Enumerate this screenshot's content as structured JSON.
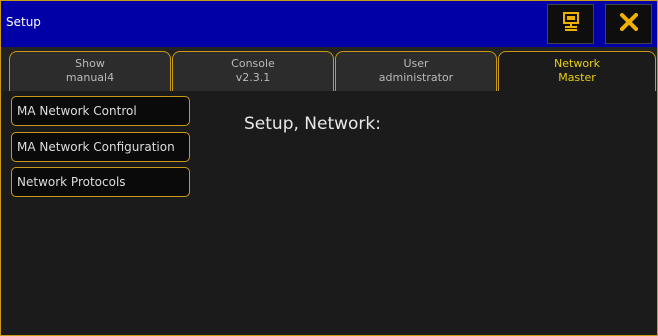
{
  "window": {
    "title": "Setup"
  },
  "titlebar_buttons": {
    "display_icon": "screen-icon",
    "close_icon": "close-icon",
    "close_symbol": "✕"
  },
  "tabs": [
    {
      "title": "Show",
      "value": "manual4",
      "active": false
    },
    {
      "title": "Console",
      "value": "v2.3.1",
      "active": false
    },
    {
      "title": "User",
      "value": "administrator",
      "active": false
    },
    {
      "title": "Network",
      "value": "Master",
      "active": true
    }
  ],
  "menu": [
    {
      "label": "MA Network Control"
    },
    {
      "label": "MA Network Configuration"
    },
    {
      "label": "Network Protocols"
    }
  ],
  "content": {
    "heading": "Setup, Network:"
  },
  "colors": {
    "titlebar": "#0000a6",
    "border_accent": "#c89a16",
    "active_tab_text": "#e8d010",
    "close_icon": "#f0b000",
    "background": "#1b1b1b"
  }
}
